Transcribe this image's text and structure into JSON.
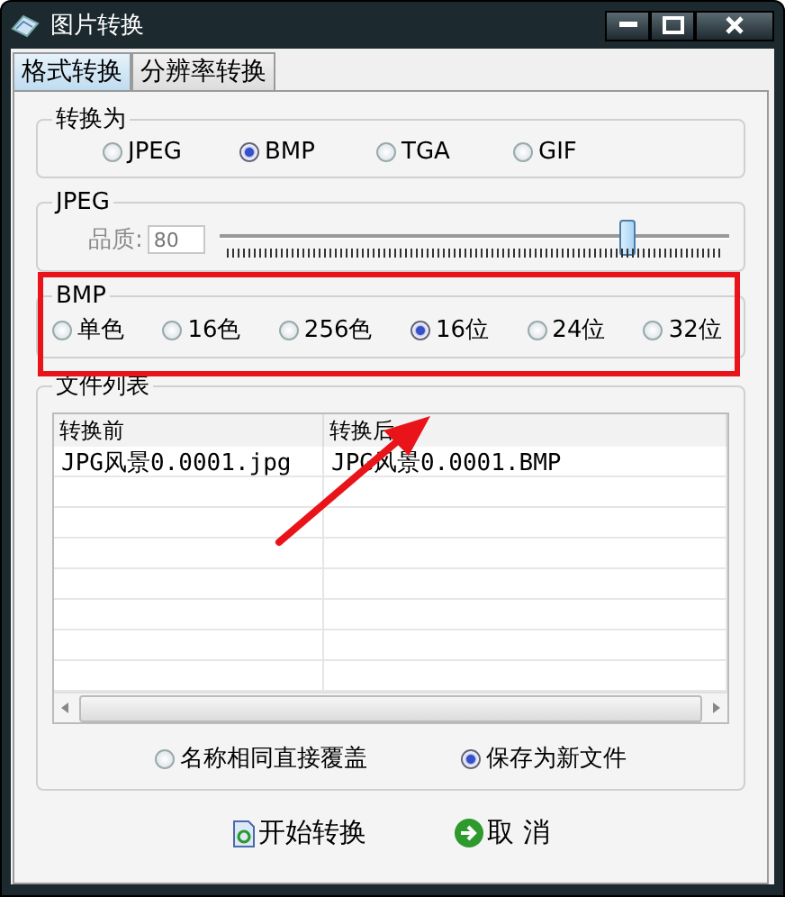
{
  "window": {
    "title": "图片转换"
  },
  "tabs": [
    {
      "label": "格式转换",
      "selected": true
    },
    {
      "label": "分辨率转换",
      "selected": false
    }
  ],
  "convert_to": {
    "title": "转换为",
    "options": [
      {
        "label": "JPEG",
        "selected": false
      },
      {
        "label": "BMP",
        "selected": true
      },
      {
        "label": "TGA",
        "selected": false
      },
      {
        "label": "GIF",
        "selected": false
      }
    ]
  },
  "jpeg": {
    "title": "JPEG",
    "quality_label": "品质:",
    "quality_value": "80",
    "disabled": true,
    "level": 0.8
  },
  "bmp": {
    "title": "BMP",
    "highlighted": true,
    "options": [
      {
        "label": "单色",
        "selected": false
      },
      {
        "label": "16色",
        "selected": false
      },
      {
        "label": "256色",
        "selected": false
      },
      {
        "label": "16位",
        "selected": true
      },
      {
        "label": "24位",
        "selected": false
      },
      {
        "label": "32位",
        "selected": false
      }
    ]
  },
  "file_list": {
    "title": "文件列表",
    "columns": [
      "转换前",
      "转换后"
    ],
    "rows": [
      [
        "JPG风景0.0001.jpg",
        "JPG风景0.0001.BMP"
      ]
    ],
    "save_options": [
      {
        "label": "名称相同直接覆盖",
        "selected": false
      },
      {
        "label": "保存为新文件",
        "selected": true
      }
    ]
  },
  "buttons": [
    {
      "kind": "start",
      "label": "开始转换"
    },
    {
      "kind": "cancel",
      "label": "取 消"
    }
  ]
}
